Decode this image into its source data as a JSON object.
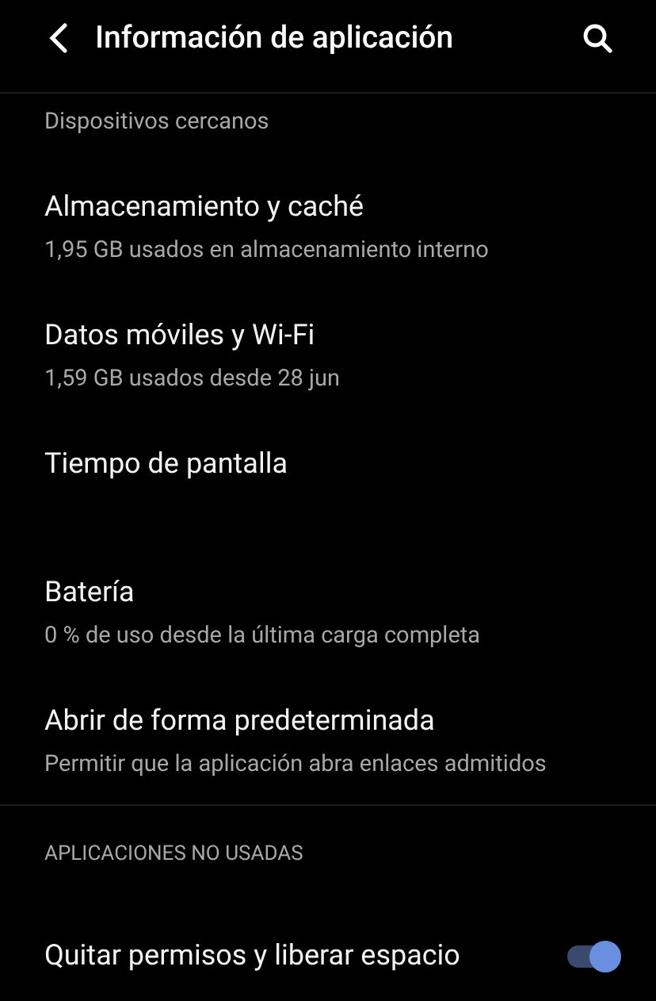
{
  "app_bar": {
    "title": "Información de aplicación"
  },
  "partial_item": {
    "subtitle": "Dispositivos cercanos"
  },
  "items": [
    {
      "title": "Almacenamiento y caché",
      "subtitle": "1,95 GB usados en almacenamiento interno"
    },
    {
      "title": "Datos móviles y Wi-Fi",
      "subtitle": "1,59 GB usados desde 28 jun"
    },
    {
      "title": "Tiempo de pantalla"
    },
    {
      "title": "Batería",
      "subtitle": "0 % de uso desde la última carga completa"
    },
    {
      "title": "Abrir de forma predeterminada",
      "subtitle": "Permitir que la aplicación abra enlaces admitidos"
    }
  ],
  "section": {
    "header": "APLICACIONES NO USADAS",
    "items": [
      {
        "kind": "toggle",
        "title": "Quitar permisos y liberar espacio",
        "on": true
      }
    ]
  }
}
